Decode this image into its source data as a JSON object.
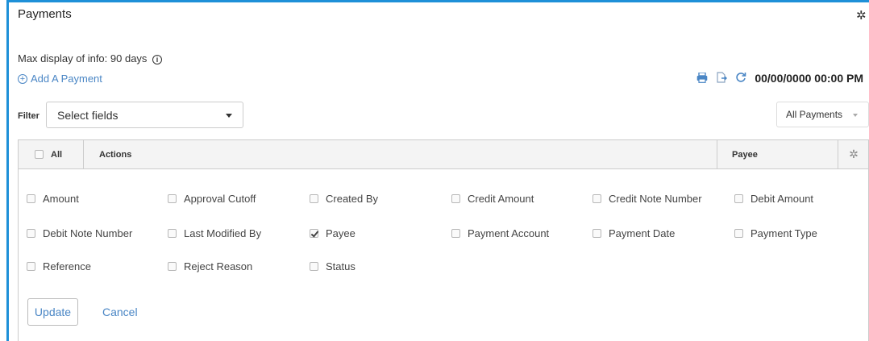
{
  "header": {
    "title": "Payments",
    "settings_icon": "gear-icon"
  },
  "info": {
    "max_display": "Max display of info: 90 days",
    "info_icon_glyph": "i"
  },
  "actions": {
    "add_payment": "Add A Payment",
    "timestamp": "00/00/0000 00:00 PM",
    "icons": [
      "print-icon",
      "export-icon",
      "refresh-icon"
    ]
  },
  "filter": {
    "label": "Filter",
    "placeholder": "Select fields",
    "view_select": "All Payments"
  },
  "grid": {
    "columns": {
      "all": "All",
      "actions": "Actions",
      "payee": "Payee"
    }
  },
  "fields": [
    {
      "label": "Amount",
      "checked": false
    },
    {
      "label": "Approval Cutoff",
      "checked": false
    },
    {
      "label": "Created By",
      "checked": false
    },
    {
      "label": "Credit Amount",
      "checked": false
    },
    {
      "label": "Credit Note Number",
      "checked": false
    },
    {
      "label": "Debit Amount",
      "checked": false
    },
    {
      "label": "Debit Note Number",
      "checked": false
    },
    {
      "label": "Last Modified By",
      "checked": false
    },
    {
      "label": "Payee",
      "checked": true
    },
    {
      "label": "Payment Account",
      "checked": false
    },
    {
      "label": "Payment Date",
      "checked": false
    },
    {
      "label": "Payment Type",
      "checked": false
    },
    {
      "label": "Reference",
      "checked": false
    },
    {
      "label": "Reject Reason",
      "checked": false
    },
    {
      "label": "Status",
      "checked": false
    }
  ],
  "buttons": {
    "update": "Update",
    "cancel": "Cancel"
  },
  "colors": {
    "accent": "#1e90d8",
    "link": "#4a86c5"
  }
}
